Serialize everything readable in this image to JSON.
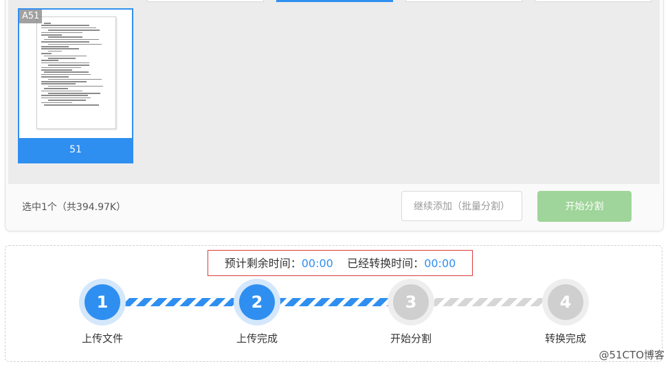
{
  "thumbnail_card": {
    "tag": "A51",
    "page_label": "51"
  },
  "footer_bar": {
    "selected_info": "选中1个（共394.97K）",
    "continue_button": "继续添加（批量分割）",
    "start_button": "开始分割"
  },
  "timer": {
    "remaining_label": "预计剩余时间：",
    "remaining_value": "00:00",
    "elapsed_label": "已经转换时间：",
    "elapsed_value": "00:00"
  },
  "steps": [
    {
      "number": "1",
      "label": "上传文件",
      "state": "done"
    },
    {
      "number": "2",
      "label": "上传完成",
      "state": "done"
    },
    {
      "number": "3",
      "label": "开始分割",
      "state": "pending"
    },
    {
      "number": "4",
      "label": "转换完成",
      "state": "pending"
    }
  ],
  "watermark": "@51CTO博客",
  "colors": {
    "accent": "#2f8ff0",
    "start_button": "#9fd49a",
    "pending": "#cfcfcf",
    "timer_border": "#d83a3a"
  }
}
